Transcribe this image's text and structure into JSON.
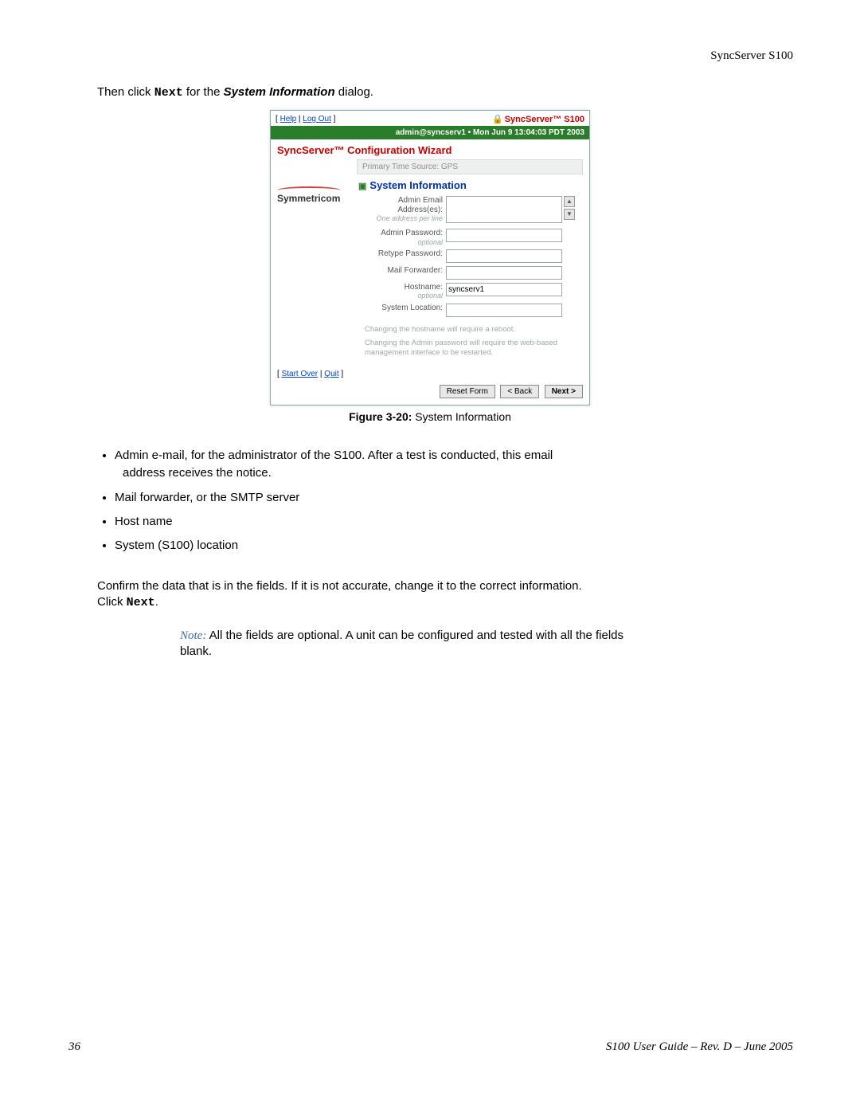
{
  "header": {
    "right": "SyncServer S100"
  },
  "intro": {
    "prefix": "Then click ",
    "next": "Next",
    "mid": " for the ",
    "dialog": "System Information",
    "suffix": " dialog."
  },
  "shot": {
    "top_links": {
      "help": "Help",
      "logout": "Log Out"
    },
    "brand": "SyncServer™ S100",
    "userbar": "admin@syncserv1  •  Mon Jun 9 13:04:03 PDT 2003",
    "wizard": "SyncServer™ Configuration Wizard",
    "logo": "Symmetricom",
    "primary": "Primary Time Source: GPS",
    "section": "System Information",
    "labels": {
      "admin_email": "Admin Email Address(es):",
      "admin_email_hint": "One address per\nline",
      "admin_pw": "Admin Password:",
      "admin_pw_hint": "optional",
      "retype_pw": "Retype Password:",
      "mail_fw": "Mail Forwarder:",
      "hostname": "Hostname:",
      "hostname_hint": "optional",
      "syslocation": "System Location:"
    },
    "values": {
      "hostname": "syncserv1"
    },
    "notes": {
      "a": "Changing the hostname will require a reboot.",
      "b": "Changing the Admin password will require the web-based management interface to be restarted."
    },
    "bottom_links": {
      "startover": "Start Over",
      "quit": "Quit"
    },
    "buttons": {
      "reset": "Reset Form",
      "back": "< Back",
      "next": "Next >"
    }
  },
  "figure": {
    "label_bold": "Figure 3-20:",
    "label_rest": "  System Information"
  },
  "bullets": {
    "b1a": "Admin e-mail, for the administrator of the S100. After a test is conducted, this email",
    "b1b": "address receives the notice.",
    "b2": "Mail forwarder, or the SMTP server",
    "b3": "Host name",
    "b4": "System (S100) location"
  },
  "confirm": {
    "line1": "Confirm the data that is in the fields. If it is not accurate, change it to the correct information.",
    "line2a": "Click ",
    "line2b": "Next",
    "line2c": "."
  },
  "note": {
    "label": "Note:",
    "text1": "  All the fields are optional. A unit can be configured and tested with all the fields",
    "text2": "blank."
  },
  "footer": {
    "left": "36",
    "right": "S100 User Guide – Rev. D – June 2005"
  }
}
